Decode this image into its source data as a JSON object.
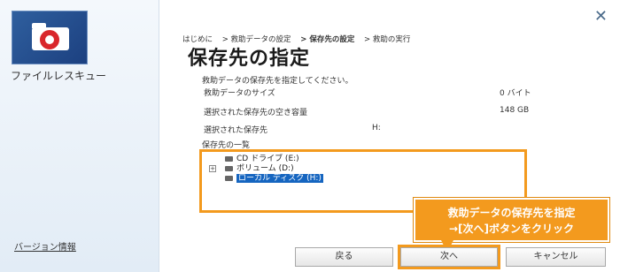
{
  "sidebar": {
    "app_name": "ファイルレスキュー",
    "version_link": "バージョン情報"
  },
  "breadcrumb": [
    "はじめに",
    "> 救助データの設定",
    "> 保存先の設定",
    "> 救助の実行"
  ],
  "page_title": "保存先の指定",
  "instruction": "救助データの保存先を指定してください。",
  "info": {
    "size_label": "救助データのサイズ",
    "size_value": "0 バイト",
    "free_label": "選択された保存先の空き容量",
    "free_value": "148 GB",
    "dest_label": "選択された保存先",
    "dest_value": "H:"
  },
  "list_heading": "保存先の一覧",
  "drives": [
    {
      "label": "CD ドライブ (E:)"
    },
    {
      "label": "ボリューム (D:)"
    },
    {
      "label": "ローカル ディスク (H:)"
    }
  ],
  "expander": "+",
  "callout": {
    "line1": "救助データの保存先を指定",
    "line2": "→[次へ]ボタンをクリック"
  },
  "buttons": {
    "back": "戻る",
    "next": "次へ",
    "cancel": "キャンセル"
  },
  "close": "✕",
  "colors": {
    "accent": "#f39a1e",
    "selection": "#1565c0"
  }
}
